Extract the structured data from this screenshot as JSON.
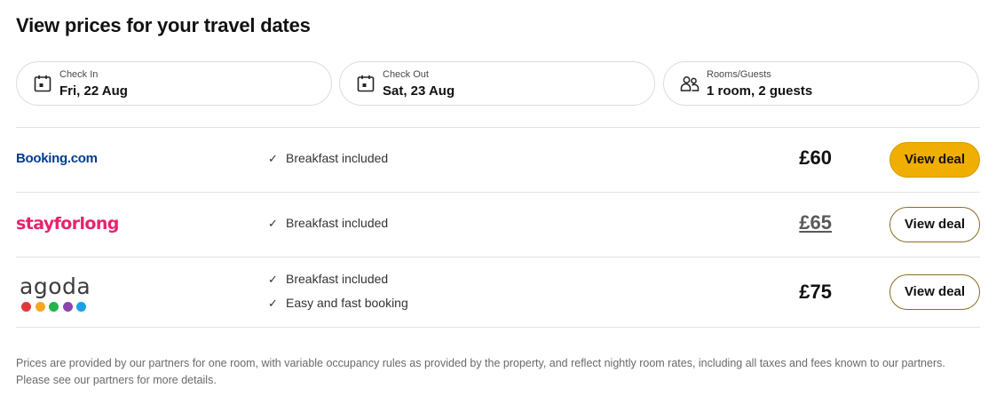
{
  "header": {
    "title": "View prices for your travel dates"
  },
  "search": {
    "check_in": {
      "label": "Check In",
      "value": "Fri, 22 Aug",
      "icon": "calendar-icon"
    },
    "check_out": {
      "label": "Check Out",
      "value": "Sat, 23 Aug",
      "icon": "calendar-icon"
    },
    "guests": {
      "label": "Rooms/Guests",
      "value": "1 room, 2 guests",
      "icon": "people-icon"
    }
  },
  "deals": [
    {
      "provider": "Booking.com",
      "features": [
        "Breakfast included"
      ],
      "price": "£60",
      "button": "View deal",
      "highlight": true
    },
    {
      "provider": "stayforlong",
      "features": [
        "Breakfast included"
      ],
      "price": "£65",
      "button": "View deal",
      "highlight": false
    },
    {
      "provider": "agoda",
      "features": [
        "Breakfast included",
        "Easy and fast booking"
      ],
      "price": "£75",
      "button": "View deal",
      "highlight": false
    }
  ],
  "footnote": "Prices are provided by our partners for one room, with variable occupancy rules as provided by the property, and reflect nightly room rates, including all taxes and fees known to our partners. Please see our partners for more details.",
  "colors": {
    "primary_button": "#f0ae00",
    "booking_brand": "#003b95",
    "stayforlong_brand": "#e8226e",
    "agoda_dots": [
      "#e2363b",
      "#f5a623",
      "#27b24a",
      "#8e44ad",
      "#1aa2e6"
    ]
  }
}
